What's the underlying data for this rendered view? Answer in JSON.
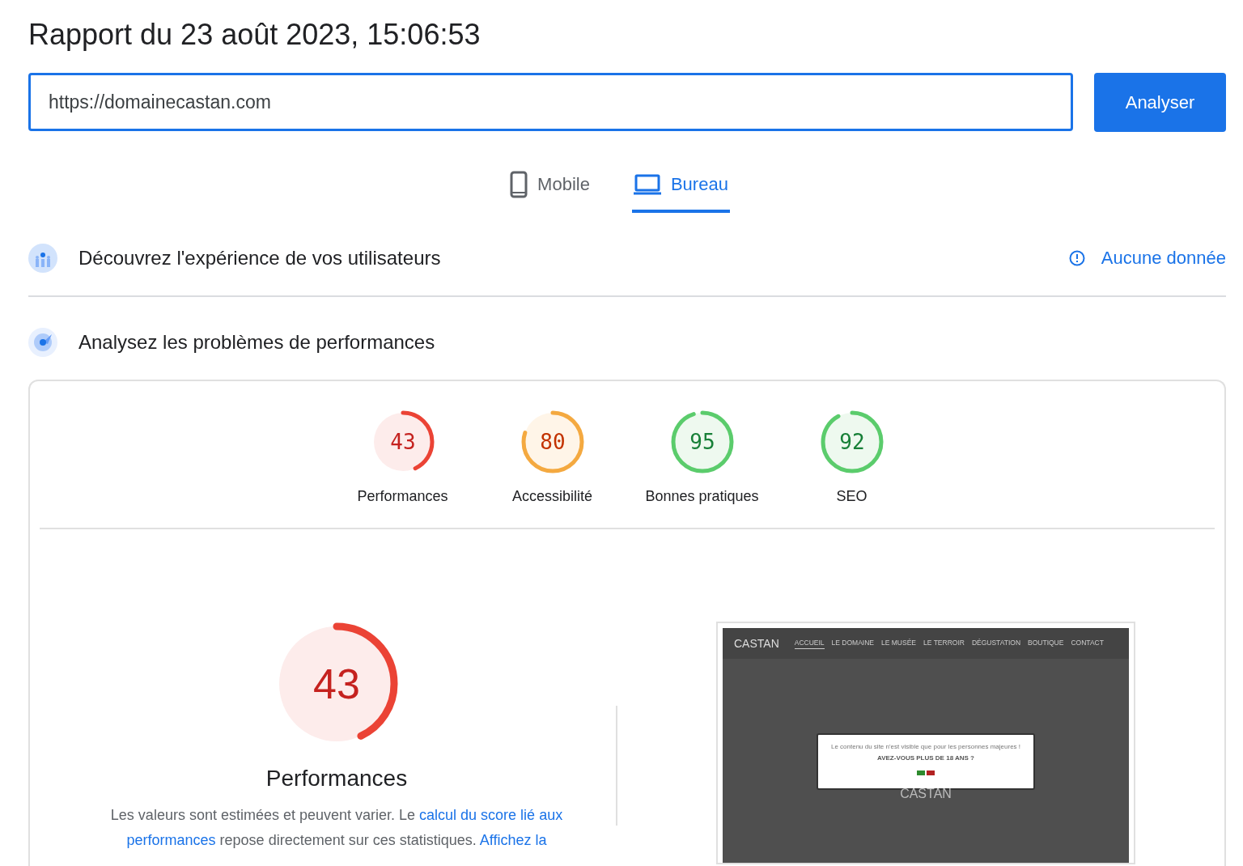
{
  "title": "Rapport du 23 août 2023, 15:06:53",
  "url_field": {
    "value": "https://domainecastan.com"
  },
  "analyze_button": "Analyser",
  "tabs": [
    {
      "label": "Mobile",
      "kind": "phone",
      "selected": false
    },
    {
      "label": "Bureau",
      "kind": "laptop",
      "selected": true
    }
  ],
  "sections": [
    {
      "kind": "users",
      "title": "Découvrez l'expérience de vos utilisateurs",
      "status": "Aucune donnée"
    },
    {
      "kind": "diagnose",
      "title": "Analysez les problèmes de performances"
    }
  ],
  "scores": [
    {
      "value": "43",
      "label": "Performances"
    },
    {
      "value": "80",
      "label": "Accessibilité"
    },
    {
      "value": "95",
      "label": "Bonnes pratiques"
    },
    {
      "value": "92",
      "label": "SEO"
    }
  ],
  "main_score": {
    "value": "43",
    "label": "Performances"
  },
  "description": [
    {
      "kind": "text",
      "text": "Les valeurs sont estimées et peuvent varier. Le "
    },
    {
      "kind": "link",
      "text": "calcul du score lié aux"
    },
    {
      "kind": "link",
      "text": "performances"
    },
    {
      "kind": "text",
      "text": " repose directement sur ces statistiques. "
    },
    {
      "kind": "link",
      "text": "Affichez la"
    }
  ],
  "site_preview": {
    "logo": "CASTAN",
    "nav": [
      {
        "label": "ACCUEIL",
        "selected": true
      },
      {
        "label": "LE DOMAINE",
        "selected": false
      },
      {
        "label": "LE MUSÉE",
        "selected": false
      },
      {
        "label": "LE TERROIR",
        "selected": false
      },
      {
        "label": "DÉGUSTATION",
        "selected": false
      },
      {
        "label": "BOUTIQUE",
        "selected": false
      },
      {
        "label": "CONTACT",
        "selected": false
      }
    ],
    "modal_text": "Le contenu du site n'est visible que pour les personnes majeures !",
    "modal_question": "AVEZ-VOUS PLUS DE 18 ANS ?",
    "hero_text": "CASTAN"
  }
}
